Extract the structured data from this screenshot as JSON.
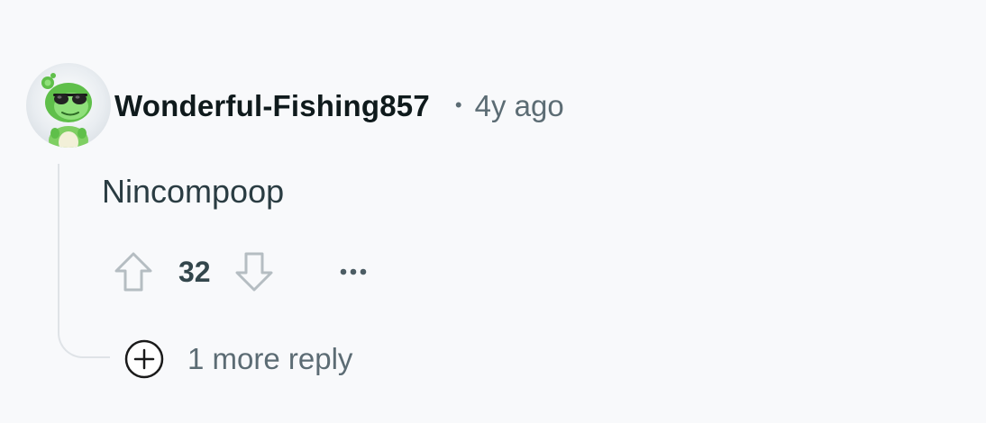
{
  "comment": {
    "username": "Wonderful-Fishing857",
    "separator": "•",
    "timestamp": "4y ago",
    "body": "Nincompoop",
    "score": "32",
    "more_replies_label": "1 more reply"
  },
  "icons": {
    "avatar": "frog-with-sunglasses-avatar",
    "upvote": "upvote-arrow-icon",
    "downvote": "downvote-arrow-icon",
    "more": "ellipsis-icon",
    "expand": "plus-circle-icon"
  },
  "colors": {
    "background": "#f8f9fb",
    "username": "#0f1a1c",
    "meta_text": "#5c6c74",
    "body_text": "#2a3c42",
    "thread_line": "#dfe3e7",
    "avatar_green": "#5fbf4a"
  }
}
